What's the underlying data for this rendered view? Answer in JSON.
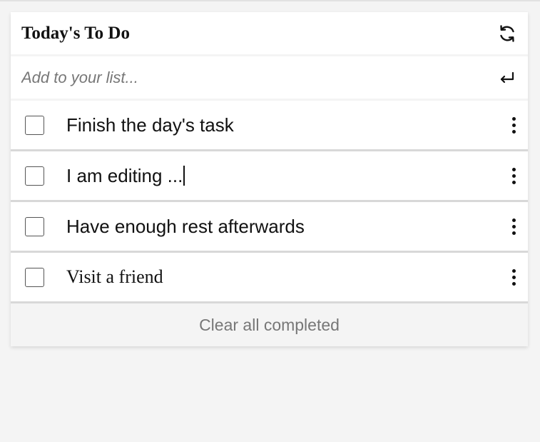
{
  "header": {
    "title": "Today's To Do",
    "refresh_icon": "refresh-icon"
  },
  "add": {
    "placeholder": "Add to your list...",
    "value": "",
    "enter_icon": "enter-return-icon"
  },
  "items": [
    {
      "text": "Finish the day's task",
      "completed": false,
      "editing": false
    },
    {
      "text": "I am editing ...",
      "completed": false,
      "editing": true
    },
    {
      "text": "Have enough rest afterwards",
      "completed": false,
      "editing": false
    },
    {
      "text": "Visit a friend",
      "completed": false,
      "editing": false
    }
  ],
  "footer": {
    "clear_label": "Clear all completed"
  }
}
